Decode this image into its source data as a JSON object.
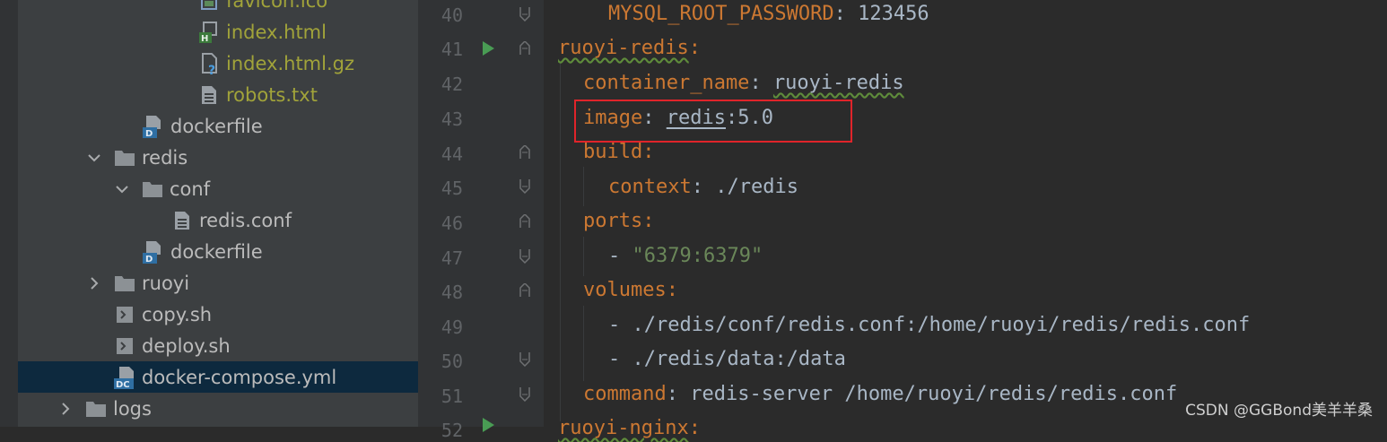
{
  "project_tree": {
    "items": [
      {
        "label": "favicon.ico",
        "icon": "image-file-icon",
        "ignored": true
      },
      {
        "label": "index.html",
        "icon": "html-file-icon",
        "ignored": true
      },
      {
        "label": "index.html.gz",
        "icon": "unknown-file-icon",
        "ignored": true
      },
      {
        "label": "robots.txt",
        "icon": "text-file-icon",
        "ignored": true
      },
      {
        "label": "dockerfile",
        "icon": "dockerfile-icon",
        "ignored": false
      },
      {
        "label": "redis",
        "icon": "folder-icon",
        "expanded": true
      },
      {
        "label": "conf",
        "icon": "folder-icon",
        "expanded": true
      },
      {
        "label": "redis.conf",
        "icon": "text-file-icon",
        "ignored": false
      },
      {
        "label": "dockerfile",
        "icon": "dockerfile-icon",
        "ignored": false
      },
      {
        "label": "ruoyi",
        "icon": "folder-icon",
        "expanded": false
      },
      {
        "label": "copy.sh",
        "icon": "shell-file-icon",
        "ignored": false
      },
      {
        "label": "deploy.sh",
        "icon": "shell-file-icon",
        "ignored": false
      },
      {
        "label": "docker-compose.yml",
        "icon": "docker-compose-icon",
        "selected": true
      },
      {
        "label": "logs",
        "icon": "folder-icon",
        "expanded": false
      }
    ]
  },
  "editor": {
    "lines": [
      {
        "num": "40",
        "key": "MYSQL_ROOT_PASSWORD",
        "sep": ": ",
        "val": "123456"
      },
      {
        "num": "41",
        "key": "ruoyi-redis",
        "sep": ":",
        "val": ""
      },
      {
        "num": "42",
        "key": "container_name",
        "sep": ": ",
        "val": "ruoyi-redis"
      },
      {
        "num": "43",
        "key": "image",
        "sep": ": ",
        "val_a": "redis",
        "val_b": ":5.0"
      },
      {
        "num": "44",
        "key": "build",
        "sep": ":",
        "val": ""
      },
      {
        "num": "45",
        "key": "context",
        "sep": ": ",
        "val": "./redis"
      },
      {
        "num": "46",
        "key": "ports",
        "sep": ":",
        "val": ""
      },
      {
        "num": "47",
        "dash": "- ",
        "str": "\"6379:6379\""
      },
      {
        "num": "48",
        "key": "volumes",
        "sep": ":",
        "val": ""
      },
      {
        "num": "49",
        "dash": "- ",
        "val": "./redis/conf/redis.conf:/home/ruoyi/redis/redis.conf"
      },
      {
        "num": "50",
        "dash": "- ",
        "val": "./redis/data:/data"
      },
      {
        "num": "51",
        "key": "command",
        "sep": ": ",
        "val": "redis-server /home/ruoyi/redis/redis.conf"
      },
      {
        "num": "52",
        "key": "ruoyi-nginx",
        "sep": ":",
        "val": ""
      }
    ]
  },
  "watermark": "CSDN @GGBond美羊羊桑",
  "colors": {
    "key": "#cc7832",
    "string": "#6a8759",
    "value": "#a9b7c6",
    "highlight": "#e0242a",
    "selection": "#0d293e"
  }
}
